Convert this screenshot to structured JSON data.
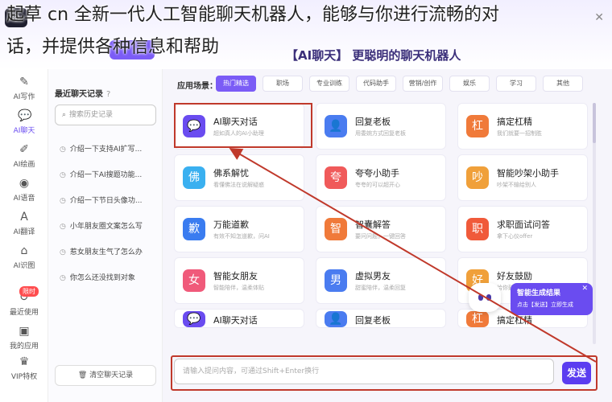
{
  "banner": {
    "line1": "起草 cn 全新一代人工智能聊天机器人，能够与你进行流畅的对",
    "line2": "话，并提供各种信息和帮助"
  },
  "header": {
    "hero_title": "【AI聊天】 更聪明的聊天机器人"
  },
  "rail": [
    {
      "icon": "✎",
      "label": "AI写作",
      "name": "rail-ai-writing-icon"
    },
    {
      "icon": "💬",
      "label": "AI聊天",
      "name": "rail-ai-chat-icon",
      "active": true
    },
    {
      "icon": "✐",
      "label": "AI绘画",
      "name": "rail-ai-draw-icon"
    },
    {
      "icon": "◉",
      "label": "AI语音",
      "name": "rail-ai-voice-icon"
    },
    {
      "icon": "A",
      "label": "AI翻译",
      "name": "rail-ai-translate-icon"
    },
    {
      "icon": "⌂",
      "label": "AI识图",
      "name": "rail-ai-image-icon"
    },
    {
      "icon": "↺",
      "label": "最近使用",
      "name": "rail-recent-icon"
    },
    {
      "icon": "▣",
      "label": "我的应用",
      "name": "rail-my-apps-icon"
    },
    {
      "icon": "♛",
      "label": "VIP特权",
      "name": "rail-vip-icon"
    }
  ],
  "history": {
    "title": "最近聊天记录",
    "help_icon": "?",
    "search_placeholder": "搜索历史记录",
    "items": [
      {
        "icon": "◷",
        "text": "介绍一下支持AI扩写..."
      },
      {
        "icon": "◷",
        "text": "介绍一下AI搜题功能..."
      },
      {
        "icon": "◷",
        "text": "介绍一下节日头像功..."
      },
      {
        "icon": "◷",
        "text": "小年朋友圈文案怎么写"
      },
      {
        "icon": "◷",
        "text": "惹女朋友生气了怎么办"
      },
      {
        "icon": "◷",
        "text": "你怎么还没找到对象"
      }
    ],
    "clear_label": "清空聊天记录"
  },
  "main": {
    "scene_label": "应用场景：",
    "tabs": [
      {
        "label": "热门精选",
        "active": true
      },
      {
        "label": "职场"
      },
      {
        "label": "专业训练"
      },
      {
        "label": "代码助手"
      },
      {
        "label": "营销/创作"
      },
      {
        "label": "娱乐"
      },
      {
        "label": "学习"
      },
      {
        "label": "其他"
      }
    ],
    "cards": [
      {
        "title": "AI聊天对话",
        "desc": "超如真人的AI小助理",
        "color": "#6a4cf0",
        "icon": "💬"
      },
      {
        "title": "回复老板",
        "desc": "用委婉方式回复老板",
        "color": "#4a7cf0",
        "icon": "👤"
      },
      {
        "title": "搞定杠精",
        "desc": "我们就要一招制胜",
        "color": "#f07a3a",
        "icon": "杠"
      },
      {
        "title": "佛系解忧",
        "desc": "看懂佛法在说解疑惑",
        "color": "#3ab0f0",
        "icon": "佛"
      },
      {
        "title": "夸夸小助手",
        "desc": "夸夸的可以超开心",
        "color": "#f05a5a",
        "icon": "夸"
      },
      {
        "title": "智能吵架小助手",
        "desc": "吵架不输给别人",
        "color": "#f0a03a",
        "icon": "吵"
      },
      {
        "title": "万能道歉",
        "desc": "有效不知怎道歉，问AI",
        "color": "#3a7cf0",
        "icon": "歉"
      },
      {
        "title": "智囊解答",
        "desc": "要问问题，一键回答",
        "color": "#f07a3a",
        "icon": "智"
      },
      {
        "title": "求职面试问答",
        "desc": "拿下心仪offer",
        "color": "#f05a3a",
        "icon": "职"
      },
      {
        "title": "智能女朋友",
        "desc": "智能陪伴，温柔体贴",
        "color": "#f05a7a",
        "icon": "女"
      },
      {
        "title": "虚拟男友",
        "desc": "甜蜜陪伴，温柔回复",
        "color": "#4a7cf0",
        "icon": "男"
      },
      {
        "title": "好友鼓励",
        "desc": "给你鼓励与安慰",
        "color": "#f0a03a",
        "icon": "好"
      },
      {
        "title": "AI聊天对话",
        "desc": "",
        "color": "#6a4cf0",
        "icon": "💬"
      },
      {
        "title": "回复老板",
        "desc": "",
        "color": "#4a7cf0",
        "icon": "👤"
      },
      {
        "title": "搞定杠精",
        "desc": "",
        "color": "#f07a3a",
        "icon": "杠"
      }
    ],
    "input_placeholder": "请输入提问内容，可通过Shift+Enter换行",
    "send_label": "发送"
  },
  "smart_popup": {
    "title": "智能生成结果",
    "desc": "点击【发送】立即生成",
    "close": "✕"
  },
  "badges": {
    "hot": "限时"
  }
}
